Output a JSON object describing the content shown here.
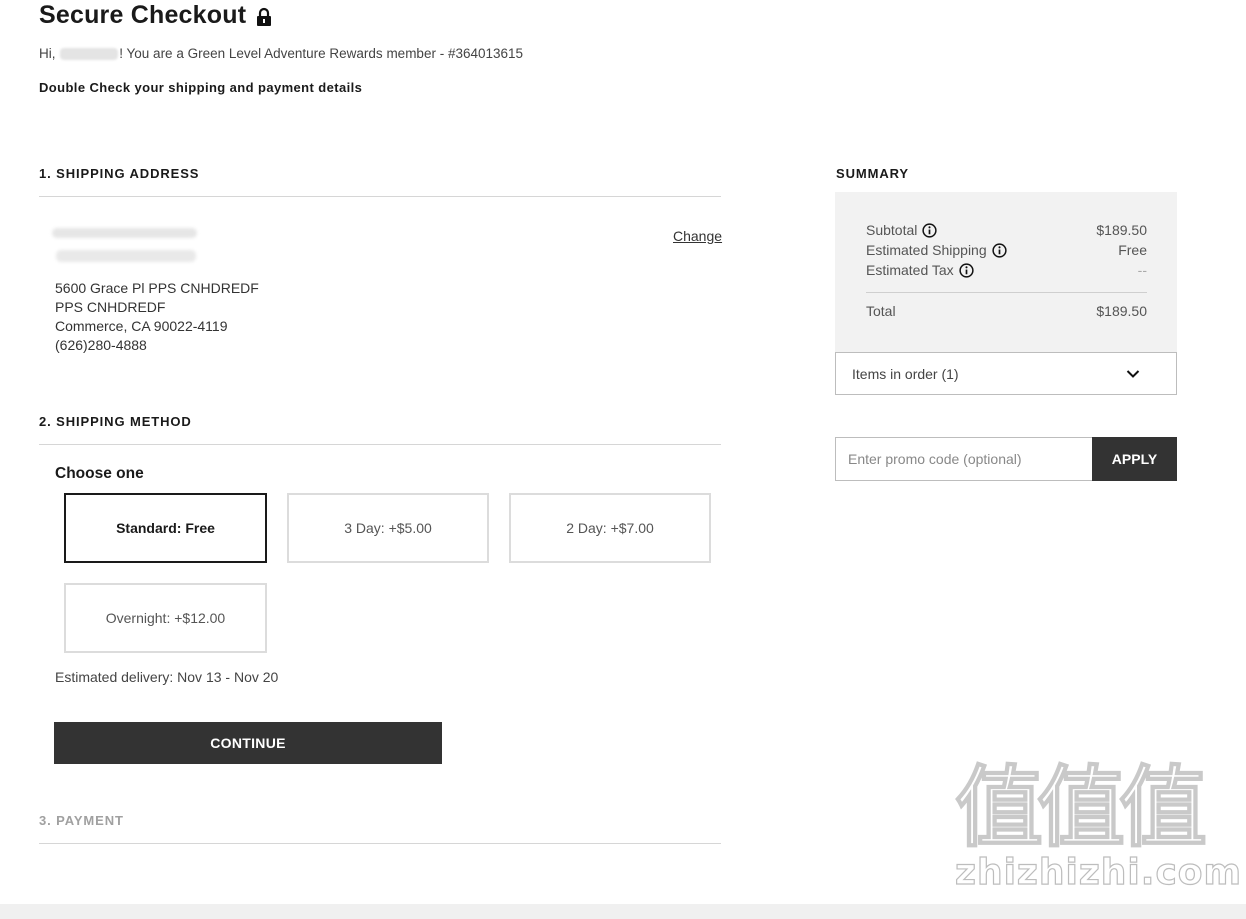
{
  "header": {
    "title": "Secure Checkout",
    "greeting_prefix": "Hi,",
    "greeting_suffix": "! You are a Green Level Adventure Rewards member - #364013615",
    "subhead": "Double Check your shipping and payment details"
  },
  "shipping_address": {
    "heading": "1. SHIPPING ADDRESS",
    "change_label": "Change",
    "lines": [
      "5600 Grace Pl PPS CNHDREDF",
      "PPS CNHDREDF",
      "Commerce, CA 90022-4119",
      "(626)280-4888"
    ]
  },
  "shipping_method": {
    "heading": "2. SHIPPING METHOD",
    "choose_label": "Choose one",
    "options": [
      {
        "label": "Standard: Free",
        "selected": true
      },
      {
        "label": "3 Day: +$5.00",
        "selected": false
      },
      {
        "label": "2 Day: +$7.00",
        "selected": false
      },
      {
        "label": "Overnight: +$12.00",
        "selected": false
      }
    ],
    "estimated_delivery": "Estimated delivery: Nov 13 - Nov 20",
    "continue_label": "CONTINUE"
  },
  "payment": {
    "heading": "3. PAYMENT"
  },
  "summary": {
    "heading": "SUMMARY",
    "rows": [
      {
        "label": "Subtotal",
        "value": "$189.50",
        "info": true
      },
      {
        "label": "Estimated Shipping",
        "value": "Free",
        "info": true
      },
      {
        "label": "Estimated Tax",
        "value": "--",
        "info": true
      }
    ],
    "total_label": "Total",
    "total_value": "$189.50",
    "items_toggle": "Items in order (1)",
    "promo_placeholder": "Enter promo code (optional)",
    "apply_label": "APPLY"
  },
  "watermark": {
    "glyphs": "值值值",
    "text": "zhizhizhi.com"
  },
  "icons": {
    "lock": "lock-icon",
    "info": "info-icon",
    "chevron": "chevron-down-icon"
  }
}
